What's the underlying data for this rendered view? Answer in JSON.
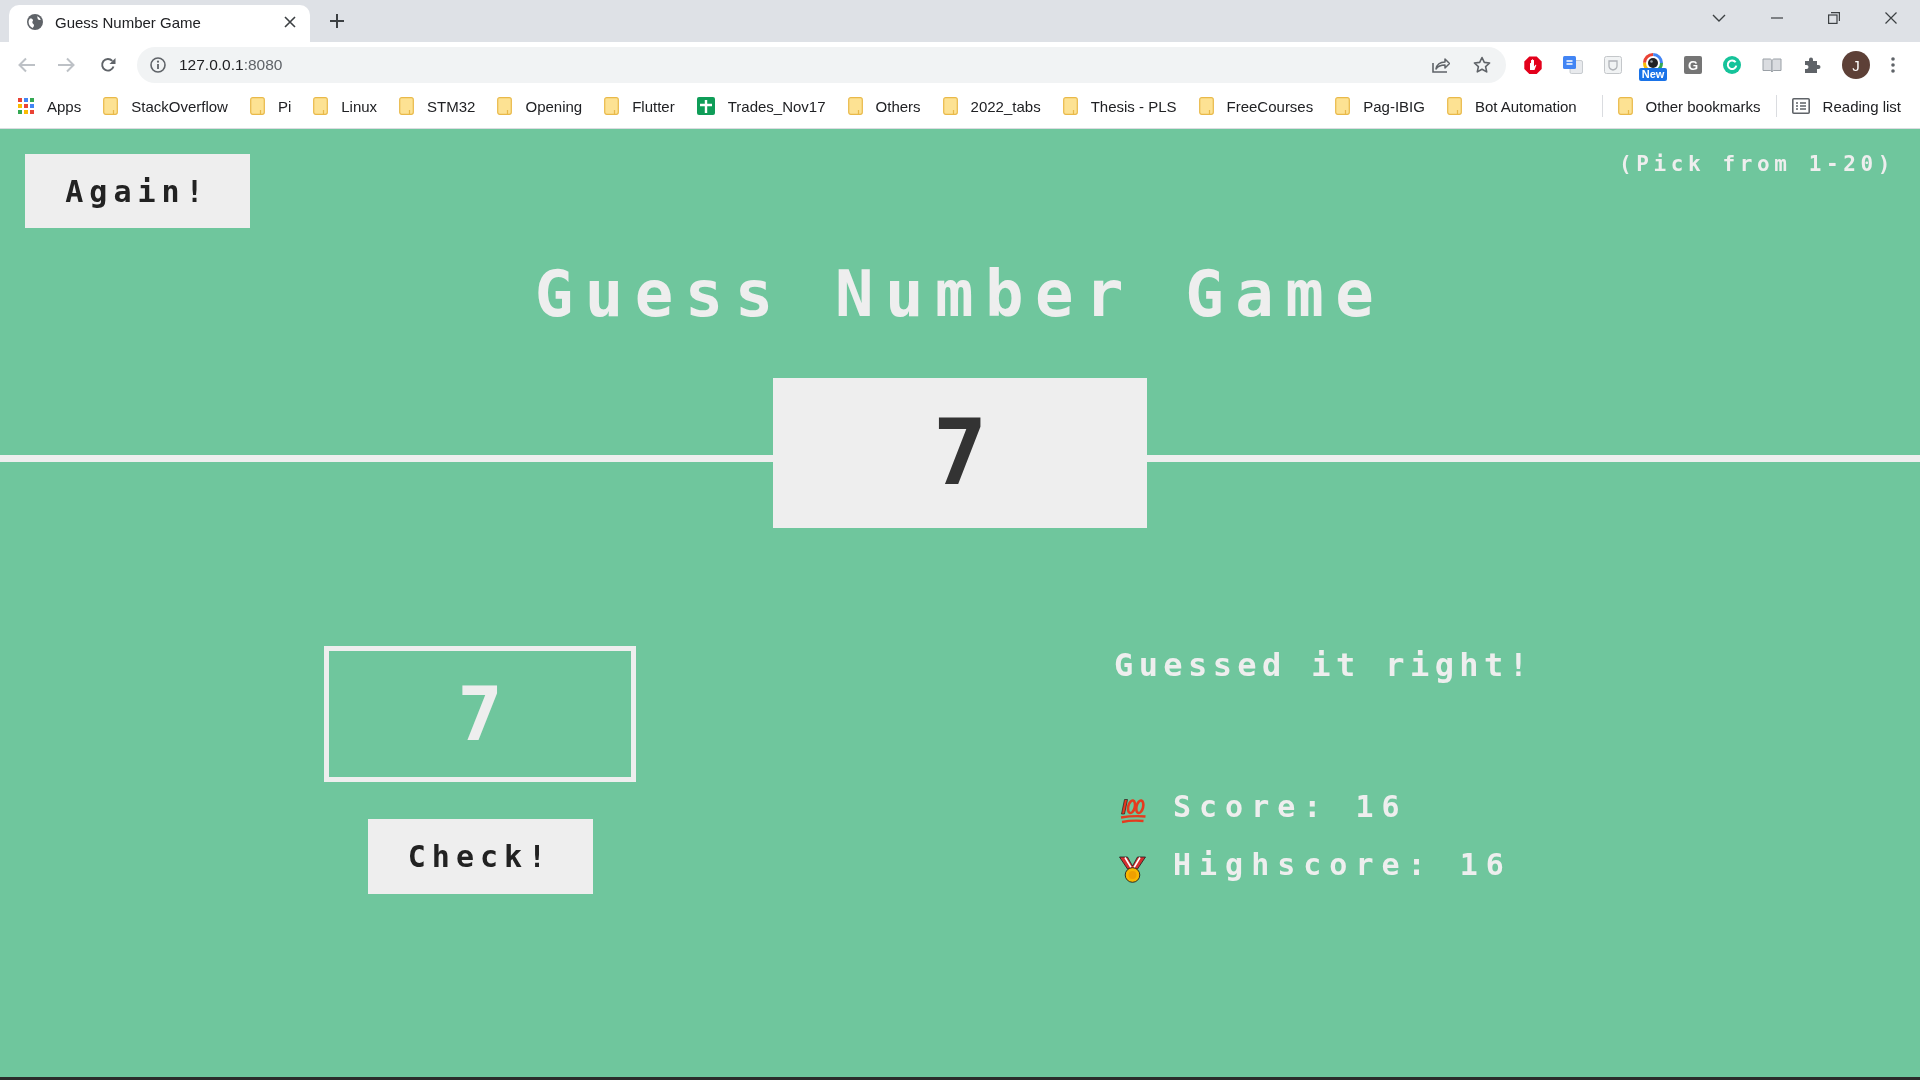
{
  "browser": {
    "tab": {
      "title": "Guess Number Game"
    },
    "nav_buttons": [
      {
        "kind": "back",
        "disabled": true
      },
      {
        "kind": "forward",
        "disabled": true
      },
      {
        "kind": "reload",
        "disabled": false
      }
    ],
    "address": {
      "host": "127.0.0.1",
      "port": ":8080"
    },
    "extensions": [
      {
        "kind": "stop"
      },
      {
        "kind": "translate"
      },
      {
        "kind": "tile"
      },
      {
        "kind": "lens",
        "badge": "New"
      },
      {
        "kind": "letter",
        "letter": "G"
      },
      {
        "kind": "ring"
      },
      {
        "kind": "reader"
      },
      {
        "kind": "puzzle"
      }
    ],
    "profile": {
      "initial": "J"
    },
    "bookmarks": [
      {
        "kind": "apps",
        "label": "Apps"
      },
      {
        "kind": "folder",
        "label": "StackOverflow"
      },
      {
        "kind": "folder",
        "label": "Pi"
      },
      {
        "kind": "folder",
        "label": "Linux"
      },
      {
        "kind": "folder",
        "label": "STM32"
      },
      {
        "kind": "folder",
        "label": "Opening"
      },
      {
        "kind": "folder",
        "label": "Flutter"
      },
      {
        "kind": "sheet",
        "label": "Trades_Nov17"
      },
      {
        "kind": "folder",
        "label": "Others"
      },
      {
        "kind": "folder",
        "label": "2022_tabs"
      },
      {
        "kind": "folder",
        "label": "Thesis - PLS"
      },
      {
        "kind": "folder",
        "label": "FreeCourses"
      },
      {
        "kind": "folder",
        "label": "Pag-IBIG"
      },
      {
        "kind": "folder",
        "label": "Bot Automation"
      }
    ],
    "other_bookmarks": {
      "label": "Other bookmarks"
    },
    "reading_list": {
      "label": "Reading list"
    }
  },
  "game": {
    "won": true,
    "again_button": "Again!",
    "hint": "(Pick from 1-20)",
    "title": "Guess Number Game",
    "secret_number": "7",
    "guess": {
      "value": "7"
    },
    "check_button": "Check!",
    "message": "Guessed it right!",
    "stats": [
      {
        "kind": "score",
        "label": "Score:",
        "value": "16"
      },
      {
        "kind": "highscore",
        "label": "Highscore:",
        "value": "16"
      }
    ]
  }
}
